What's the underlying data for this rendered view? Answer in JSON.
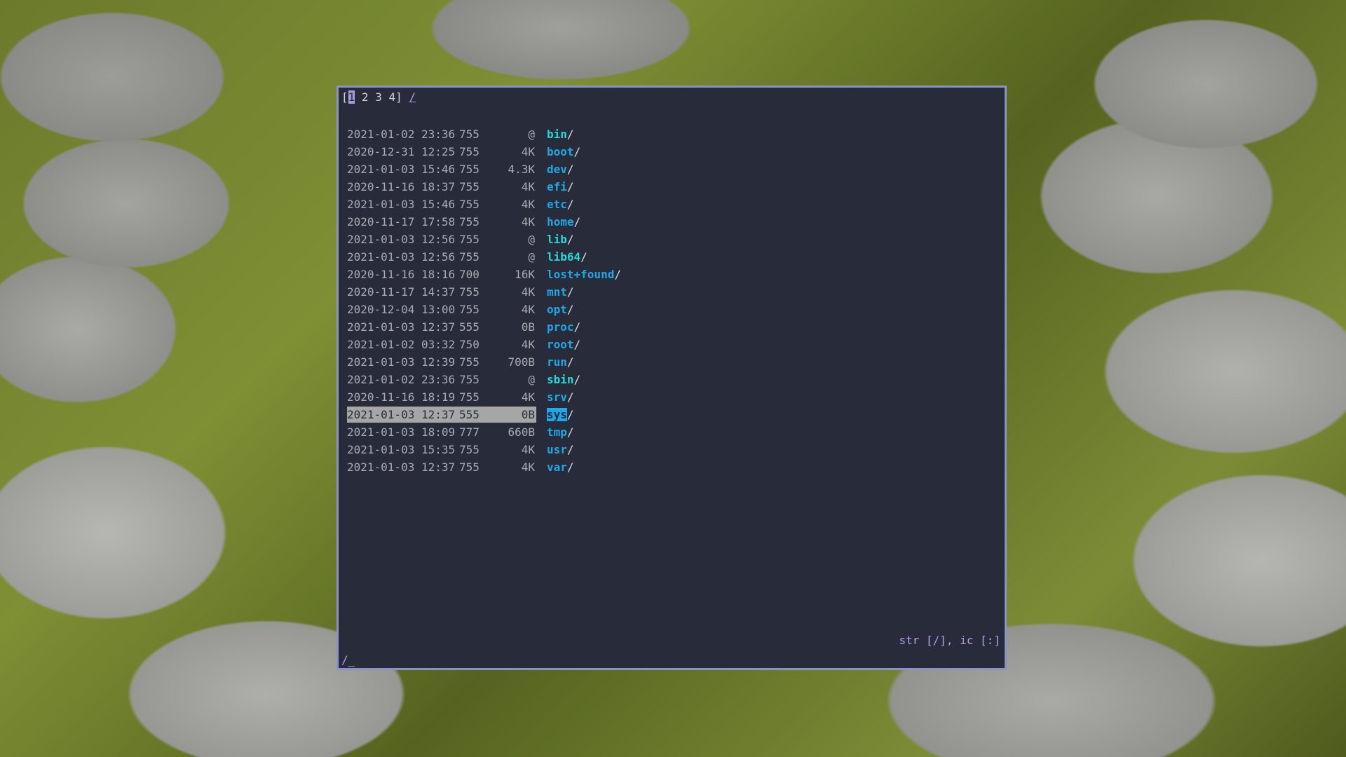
{
  "tabbar": {
    "open_bracket": "[",
    "active_tab": "1",
    "tabs": [
      "2",
      "3",
      "4"
    ],
    "close_bracket": "]",
    "current_path": "/"
  },
  "listing": {
    "rows": [
      {
        "date": "2021-01-02 23:36",
        "perm": "755",
        "size": "@",
        "name": "bin",
        "suffix": "/",
        "link": true
      },
      {
        "date": "2020-12-31 12:25",
        "perm": "755",
        "size": "4K",
        "name": "boot",
        "suffix": "/",
        "link": false
      },
      {
        "date": "2021-01-03 15:46",
        "perm": "755",
        "size": "4.3K",
        "name": "dev",
        "suffix": "/",
        "link": false
      },
      {
        "date": "2020-11-16 18:37",
        "perm": "755",
        "size": "4K",
        "name": "efi",
        "suffix": "/",
        "link": false
      },
      {
        "date": "2021-01-03 15:46",
        "perm": "755",
        "size": "4K",
        "name": "etc",
        "suffix": "/",
        "link": false
      },
      {
        "date": "2020-11-17 17:58",
        "perm": "755",
        "size": "4K",
        "name": "home",
        "suffix": "/",
        "link": false
      },
      {
        "date": "2021-01-03 12:56",
        "perm": "755",
        "size": "@",
        "name": "lib",
        "suffix": "/",
        "link": true
      },
      {
        "date": "2021-01-03 12:56",
        "perm": "755",
        "size": "@",
        "name": "lib64",
        "suffix": "/",
        "link": true
      },
      {
        "date": "2020-11-16 18:16",
        "perm": "700",
        "size": "16K",
        "name": "lost+found",
        "suffix": "/",
        "link": false
      },
      {
        "date": "2020-11-17 14:37",
        "perm": "755",
        "size": "4K",
        "name": "mnt",
        "suffix": "/",
        "link": false
      },
      {
        "date": "2020-12-04 13:00",
        "perm": "755",
        "size": "4K",
        "name": "opt",
        "suffix": "/",
        "link": false
      },
      {
        "date": "2021-01-03 12:37",
        "perm": "555",
        "size": "0B",
        "name": "proc",
        "suffix": "/",
        "link": false
      },
      {
        "date": "2021-01-02 03:32",
        "perm": "750",
        "size": "4K",
        "name": "root",
        "suffix": "/",
        "link": false
      },
      {
        "date": "2021-01-03 12:39",
        "perm": "755",
        "size": "700B",
        "name": "run",
        "suffix": "/",
        "link": false
      },
      {
        "date": "2021-01-02 23:36",
        "perm": "755",
        "size": "@",
        "name": "sbin",
        "suffix": "/",
        "link": true
      },
      {
        "date": "2020-11-16 18:19",
        "perm": "755",
        "size": "4K",
        "name": "srv",
        "suffix": "/",
        "link": false
      },
      {
        "date": "2021-01-03 12:37",
        "perm": "555",
        "size": "0B",
        "name": "sys",
        "suffix": "/",
        "link": false,
        "selected": true
      },
      {
        "date": "2021-01-03 18:09",
        "perm": "777",
        "size": "660B",
        "name": "tmp",
        "suffix": "/",
        "link": false
      },
      {
        "date": "2021-01-03 15:35",
        "perm": "755",
        "size": "4K",
        "name": "usr",
        "suffix": "/",
        "link": false
      },
      {
        "date": "2021-01-03 12:37",
        "perm": "755",
        "size": "4K",
        "name": "var",
        "suffix": "/",
        "link": false
      }
    ]
  },
  "status": {
    "text": "str [/], ic [:]"
  },
  "cmdline": {
    "text": "/",
    "cursor": "_"
  },
  "colors": {
    "terminal_bg": "#282c3a",
    "border": "#8b93c4",
    "directory": "#1ea9e6",
    "symlink": "#26d9d9",
    "accent": "#b09be8",
    "selection": "#a6a6a6"
  }
}
